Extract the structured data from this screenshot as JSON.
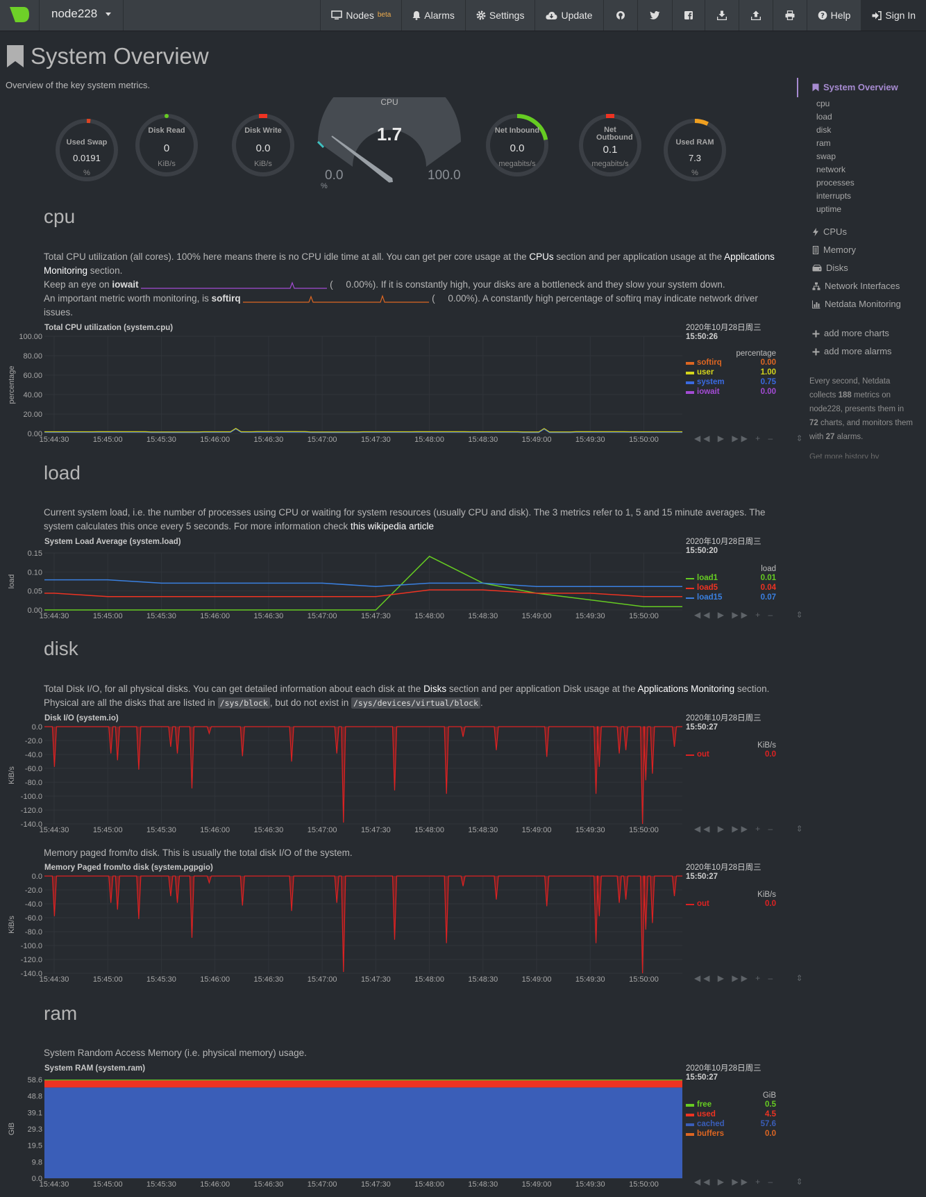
{
  "navbar": {
    "node_name": "node228",
    "items": [
      {
        "label": "Nodes",
        "sup": "beta",
        "icon": "monitor-icon"
      },
      {
        "label": "Alarms",
        "icon": "bell-icon"
      },
      {
        "label": "Settings",
        "icon": "gear-icon"
      },
      {
        "label": "Update",
        "icon": "cloud-download-icon"
      }
    ],
    "icon_buttons": [
      "github-icon",
      "twitter-icon",
      "facebook-icon",
      "download-icon",
      "upload-icon",
      "print-icon"
    ],
    "help": "Help",
    "signin": "Sign In"
  },
  "page": {
    "title": "System Overview",
    "subtitle": "Overview of the key system metrics."
  },
  "gauges": {
    "swap": {
      "title": "Used Swap",
      "value": "0.0191",
      "unit": "%",
      "fraction": 0.02
    },
    "disk_read": {
      "title": "Disk Read",
      "value": "0",
      "unit": "KiB/s",
      "fraction": 0.0
    },
    "disk_write": {
      "title": "Disk Write",
      "value": "0.0",
      "unit": "KiB/s",
      "fraction": 0.0
    },
    "cpu": {
      "title": "CPU",
      "value": "1.7",
      "min": "0.0",
      "max": "100.0",
      "unit": "%",
      "fraction": 0.017
    },
    "net_in": {
      "title": "Net Inbound",
      "value": "0.0",
      "unit": "megabits/s",
      "fraction": 0.22
    },
    "net_out": {
      "title": "Net Outbound",
      "value": "0.1",
      "unit": "megabits/s",
      "fraction": 0.0
    },
    "ram": {
      "title": "Used RAM",
      "value": "7.3",
      "unit": "%",
      "fraction": 0.073
    }
  },
  "sections": {
    "cpu": {
      "title": "cpu",
      "p1a": "Total CPU utilization (all cores). 100% here means there is no CPU idle time at all. You can get per core usage at the",
      "p1_link1": "CPUs",
      "p1b": "section and per application usage at the",
      "p1_link2": "Applications Monitoring",
      "p1c": "section.",
      "p2a": "Keep an eye on",
      "p2_bold": "iowait",
      "p2_open": "(",
      "p2_val": "0.00%",
      "p2b": "). If it is constantly high, your disks are a bottleneck and they slow your system down.",
      "p3a": "An important metric worth monitoring, is",
      "p3_bold": "softirq",
      "p3_open": "(",
      "p3_val": "0.00%",
      "p3b": "). A constantly high percentage of softirq may indicate network driver issues."
    },
    "load": {
      "title": "load",
      "p1": "Current system load, i.e. the number of processes using CPU or waiting for system resources (usually CPU and disk). The 3 metrics refer to 1, 5 and 15 minute averages. The system calculates this once every 5 seconds. For more information check",
      "p1_link": "this wikipedia article"
    },
    "disk": {
      "title": "disk",
      "p1a": "Total Disk I/O, for all physical disks. You can get detailed information about each disk at the",
      "p1_link1": "Disks",
      "p1b": "section and per application Disk usage at the",
      "p1_link2": "Applications Monitoring",
      "p1c": "section. Physical are all the disks that are listed in",
      "code1": "/sys/block",
      "p1d": ", but do not exist in",
      "code2": "/sys/devices/virtual/block",
      "p1e": ".",
      "p2": "Memory paged from/to disk. This is usually the total disk I/O of the system."
    },
    "ram": {
      "title": "ram",
      "p1": "System Random Access Memory (i.e. physical memory) usage."
    }
  },
  "sidebar": {
    "main": "System Overview",
    "sub": [
      "cpu",
      "load",
      "disk",
      "ram",
      "swap",
      "network",
      "processes",
      "interrupts",
      "uptime"
    ],
    "items": [
      {
        "label": "CPUs",
        "icon": "bolt-icon"
      },
      {
        "label": "Memory",
        "icon": "memory-icon"
      },
      {
        "label": "Disks",
        "icon": "hdd-icon"
      },
      {
        "label": "Network Interfaces",
        "icon": "network-icon"
      },
      {
        "label": "Netdata Monitoring",
        "icon": "chart-icon"
      }
    ],
    "add_charts": "add more charts",
    "add_alarms": "add more alarms",
    "note_a": "Every second, Netdata collects",
    "note_metrics": "188",
    "note_b": "metrics on node228, presents them in",
    "note_charts": "72",
    "note_c": "charts, and monitors them with",
    "note_alarms": "27",
    "note_d": "alarms.",
    "more_history": "Get more history by"
  },
  "colors": {
    "bg": "#272b30",
    "navbar": "#3a3f44",
    "accent": "#a78bd1",
    "softirq": "#dd6622",
    "user": "#d4d41c",
    "system": "#3a6ae0",
    "iowait": "#a34bd4",
    "load1": "#66cc22",
    "load5": "#ee3322",
    "load15": "#3a80e0",
    "out": "#dd2222",
    "free": "#66cc22",
    "used": "#ee3322",
    "cached": "#3a5eb8",
    "buffers": "#dd6622"
  },
  "chart_data": [
    {
      "type": "line",
      "title": "Total CPU utilization (system.cpu)",
      "ylabel": "percentage",
      "ylim": [
        0,
        100
      ],
      "yticks": [
        "100.00",
        "80.00",
        "60.00",
        "40.00",
        "20.00",
        "0.00"
      ],
      "x": [
        "15:44:30",
        "15:45:00",
        "15:45:30",
        "15:46:00",
        "15:46:30",
        "15:47:00",
        "15:47:30",
        "15:48:00",
        "15:48:30",
        "15:49:00",
        "15:49:30",
        "15:50:00"
      ],
      "date": "2020年10月28日周三",
      "time": "15:50:26",
      "units": "percentage",
      "series": [
        {
          "name": "softirq",
          "value": "0.00",
          "color": "#dd6622"
        },
        {
          "name": "user",
          "value": "1.00",
          "color": "#d4d41c"
        },
        {
          "name": "system",
          "value": "0.75",
          "color": "#3a6ae0"
        },
        {
          "name": "iowait",
          "value": "0.00",
          "color": "#a34bd4"
        }
      ],
      "values": [
        1.7,
        1.8,
        1.6,
        1.7,
        1.9,
        1.6,
        1.7,
        1.8,
        1.7,
        1.6,
        1.8,
        1.7
      ]
    },
    {
      "type": "line",
      "title": "System Load Average (system.load)",
      "ylabel": "load",
      "ylim": [
        0,
        0.17
      ],
      "yticks": [
        "0.15",
        "0.10",
        "0.05",
        "0.00"
      ],
      "x": [
        "15:44:30",
        "15:45:00",
        "15:45:30",
        "15:46:00",
        "15:46:30",
        "15:47:00",
        "15:47:30",
        "15:48:00",
        "15:48:30",
        "15:49:00",
        "15:49:30",
        "15:50:00"
      ],
      "date": "2020年10月28日周三",
      "time": "15:50:20",
      "units": "load",
      "series": [
        {
          "name": "load1",
          "value": "0.01",
          "color": "#66cc22",
          "values": [
            0.0,
            0.0,
            0.0,
            0.0,
            0.0,
            0.0,
            0.0,
            0.16,
            0.08,
            0.05,
            0.03,
            0.01
          ]
        },
        {
          "name": "load5",
          "value": "0.04",
          "color": "#ee3322",
          "values": [
            0.05,
            0.04,
            0.04,
            0.04,
            0.04,
            0.04,
            0.04,
            0.06,
            0.06,
            0.05,
            0.05,
            0.04
          ]
        },
        {
          "name": "load15",
          "value": "0.07",
          "color": "#3a80e0",
          "values": [
            0.09,
            0.09,
            0.08,
            0.08,
            0.08,
            0.08,
            0.07,
            0.08,
            0.08,
            0.07,
            0.07,
            0.07
          ]
        }
      ]
    },
    {
      "type": "area",
      "title": "Disk I/O (system.io)",
      "ylabel": "KiB/s",
      "ylim": [
        -145,
        0
      ],
      "yticks": [
        "0.0",
        "-20.0",
        "-40.0",
        "-60.0",
        "-80.0",
        "-100.0",
        "-120.0",
        "-140.0"
      ],
      "x": [
        "15:44:30",
        "15:45:00",
        "15:45:30",
        "15:46:00",
        "15:46:30",
        "15:47:00",
        "15:47:30",
        "15:48:00",
        "15:48:30",
        "15:49:00",
        "15:49:30",
        "15:50:00"
      ],
      "date": "2020年10月28日周三",
      "time": "15:50:27",
      "units": "KiB/s",
      "series": [
        {
          "name": "out",
          "value": "0.0",
          "color": "#dd2222"
        }
      ],
      "spikes": [
        [
          15,
          -60
        ],
        [
          100,
          -40
        ],
        [
          110,
          -50
        ],
        [
          142,
          -64
        ],
        [
          190,
          -30
        ],
        [
          200,
          -40
        ],
        [
          222,
          -92
        ],
        [
          248,
          -10
        ],
        [
          298,
          -44
        ],
        [
          372,
          -52
        ],
        [
          440,
          -40
        ],
        [
          450,
          -143
        ],
        [
          527,
          -95
        ],
        [
          605,
          -100
        ],
        [
          630,
          -15
        ],
        [
          680,
          -35
        ],
        [
          756,
          -45
        ],
        [
          830,
          -100
        ],
        [
          835,
          -60
        ],
        [
          865,
          -40
        ],
        [
          875,
          -35
        ],
        [
          900,
          -145
        ],
        [
          905,
          -80
        ],
        [
          915,
          -70
        ],
        [
          948,
          -30
        ]
      ]
    },
    {
      "type": "area",
      "title": "Memory Paged from/to disk (system.pgpgio)",
      "ylabel": "KiB/s",
      "ylim": [
        -145,
        0
      ],
      "yticks": [
        "0.0",
        "-20.0",
        "-40.0",
        "-60.0",
        "-80.0",
        "-100.0",
        "-120.0",
        "-140.0"
      ],
      "x": [
        "15:44:30",
        "15:45:00",
        "15:45:30",
        "15:46:00",
        "15:46:30",
        "15:47:00",
        "15:47:30",
        "15:48:00",
        "15:48:30",
        "15:49:00",
        "15:49:30",
        "15:50:00"
      ],
      "date": "2020年10月28日周三",
      "time": "15:50:27",
      "units": "KiB/s",
      "series": [
        {
          "name": "out",
          "value": "0.0",
          "color": "#dd2222"
        }
      ],
      "spikes": [
        [
          15,
          -60
        ],
        [
          100,
          -40
        ],
        [
          110,
          -50
        ],
        [
          142,
          -64
        ],
        [
          190,
          -30
        ],
        [
          200,
          -40
        ],
        [
          222,
          -92
        ],
        [
          248,
          -10
        ],
        [
          298,
          -44
        ],
        [
          372,
          -52
        ],
        [
          440,
          -40
        ],
        [
          450,
          -143
        ],
        [
          527,
          -95
        ],
        [
          605,
          -100
        ],
        [
          630,
          -15
        ],
        [
          680,
          -35
        ],
        [
          756,
          -45
        ],
        [
          830,
          -100
        ],
        [
          835,
          -60
        ],
        [
          865,
          -40
        ],
        [
          875,
          -35
        ],
        [
          900,
          -145
        ],
        [
          905,
          -80
        ],
        [
          915,
          -70
        ],
        [
          948,
          -30
        ]
      ]
    },
    {
      "type": "area",
      "title": "System RAM (system.ram)",
      "ylabel": "GiB",
      "ylim": [
        0,
        62.6
      ],
      "yticks": [
        "58.6",
        "48.8",
        "39.1",
        "29.3",
        "19.5",
        "9.8",
        "0.0"
      ],
      "x": [
        "15:44:30",
        "15:45:00",
        "15:45:30",
        "15:46:00",
        "15:46:30",
        "15:47:00",
        "15:47:30",
        "15:48:00",
        "15:48:30",
        "15:49:00",
        "15:49:30",
        "15:50:00"
      ],
      "date": "2020年10月28日周三",
      "time": "15:50:27",
      "units": "GiB",
      "series": [
        {
          "name": "free",
          "value": "0.5",
          "color": "#66cc22"
        },
        {
          "name": "used",
          "value": "4.5",
          "color": "#ee3322"
        },
        {
          "name": "cached",
          "value": "57.6",
          "color": "#3a5eb8"
        },
        {
          "name": "buffers",
          "value": "0.0",
          "color": "#dd6622"
        }
      ],
      "stack": {
        "cached": 57.6,
        "used": 4.5,
        "free": 0.5
      }
    }
  ]
}
